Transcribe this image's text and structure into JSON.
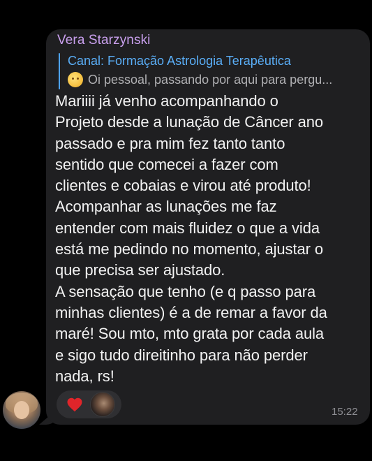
{
  "message": {
    "sender": "Vera Starzynski",
    "reply": {
      "title": "Canal: Formação Astrologia Terapêutica",
      "snippet_icon": "sun-emoji",
      "snippet": "Oi pessoal, passando por aqui para pergu..."
    },
    "lines": [
      "Mariiii já venho acompanhando o",
      "Projeto desde a lunação de Câncer ano",
      "passado e pra mim fez tanto tanto",
      "sentido que comecei a fazer com",
      "clientes e cobaias e virou até produto!",
      "Acompanhar as lunações me faz",
      "entender com mais fluidez o que a vida",
      "está me pedindo no momento, ajustar o",
      "que precisa ser ajustado.",
      "A sensação que tenho (e q passo para",
      "minhas clientes) é a de remar a favor da",
      "maré! Sou mto, mto grata por cada aula",
      "e sigo tudo direitinho para não perder",
      "nada, rs!"
    ],
    "reactions": [
      {
        "icon": "heart-icon",
        "color": "#e0252a"
      },
      {
        "icon": "reactor-avatar"
      }
    ],
    "time": "15:22"
  },
  "colors": {
    "background": "#000000",
    "bubble": "#1f1f21",
    "sender": "#c9a0ee",
    "reply_accent": "#4ea3f1",
    "text": "#f2f2f2",
    "timestamp": "#8e8e93"
  }
}
